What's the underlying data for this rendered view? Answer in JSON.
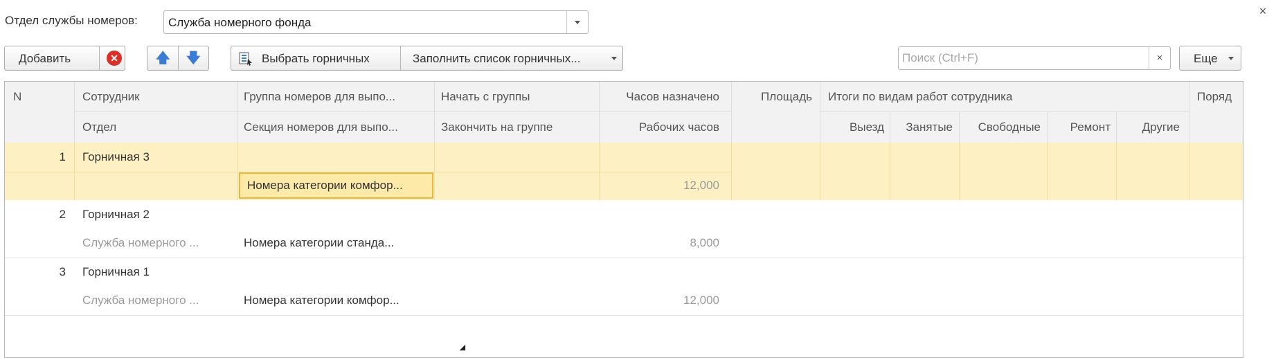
{
  "form": {
    "close_label": "×",
    "department_label": "Отдел службы номеров:",
    "department_value": "Служба номерного фонда"
  },
  "toolbar": {
    "add_label": "Добавить",
    "select_maids_label": "Выбрать горничных",
    "fill_list_label": "Заполнить список горничных...",
    "more_label": "Еще"
  },
  "search": {
    "placeholder": "Поиск (Ctrl+F)",
    "clear_label": "×"
  },
  "table": {
    "headers": {
      "n": "N",
      "employee": "Сотрудник",
      "department": "Отдел",
      "room_group": "Группа номеров для выпо...",
      "room_section": "Секция номеров для выпо...",
      "start_group": "Начать с группы",
      "end_group": "Закончить на группе",
      "hours_assigned": "Часов назначено",
      "work_hours": "Рабочих часов",
      "area": "Площадь",
      "totals": "Итоги по видам работ сотрудника",
      "checkout": "Выезд",
      "occupied": "Занятые",
      "free": "Свободные",
      "repair": "Ремонт",
      "other": "Другие",
      "order": "Поряд"
    },
    "rows": [
      {
        "n": "1",
        "employee": "Горничная 3",
        "department": "",
        "section": "Номера категории комфор...",
        "work_hours": "12,000"
      },
      {
        "n": "2",
        "employee": "Горничная 2",
        "department": "Служба номерного ...",
        "section": "Номера категории станда...",
        "work_hours": "8,000"
      },
      {
        "n": "3",
        "employee": "Горничная 1",
        "department": "Служба номерного ...",
        "section": "Номера категории комфор...",
        "work_hours": "12,000"
      }
    ]
  }
}
